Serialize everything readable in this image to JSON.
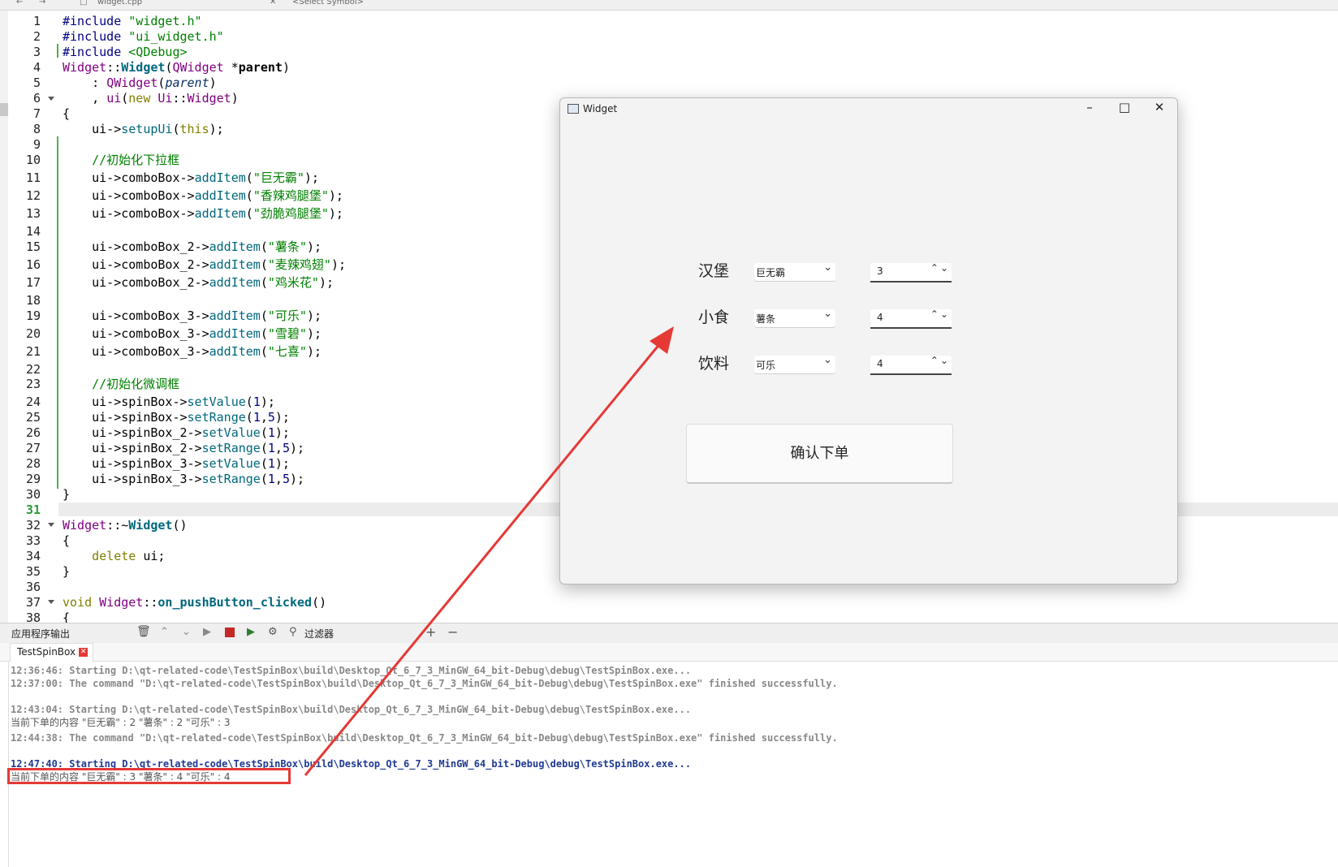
{
  "topbar": {
    "file_tab": "widget.cpp",
    "symbol": "<Select Symbol>"
  },
  "editor": {
    "line_numbers": [
      "1",
      "2",
      "3",
      "4",
      "5",
      "6",
      "7",
      "8",
      "9",
      "10",
      "11",
      "12",
      "13",
      "14",
      "15",
      "16",
      "17",
      "18",
      "19",
      "20",
      "21",
      "22",
      "23",
      "24",
      "25",
      "26",
      "27",
      "28",
      "29",
      "30",
      "31",
      "32",
      "33",
      "34",
      "35",
      "36",
      "37",
      "38"
    ],
    "current_line": "31"
  },
  "code": {
    "l1": [
      "#include ",
      "\"widget.h\""
    ],
    "l2": [
      "#include ",
      "\"ui_widget.h\""
    ],
    "l3": [
      "#include ",
      "<QDebug>"
    ],
    "l4": [
      "Widget",
      "::",
      "Widget",
      "(",
      "QWidget",
      " *",
      "parent",
      ")"
    ],
    "l5": [
      "    : ",
      "QWidget",
      "(",
      "parent",
      ")"
    ],
    "l6": [
      "    , ",
      "ui",
      "(",
      "new",
      " ",
      "Ui",
      "::",
      "Widget",
      ")"
    ],
    "l7": "{",
    "l8": [
      "    ui->",
      "setupUi",
      "(",
      "this",
      ");"
    ],
    "l10": "    //初始化下拉框",
    "l11": [
      "    ui->comboBox->",
      "addItem",
      "(",
      "\"巨无霸\"",
      ");"
    ],
    "l12": [
      "    ui->comboBox->",
      "addItem",
      "(",
      "\"香辣鸡腿堡\"",
      ");"
    ],
    "l13": [
      "    ui->comboBox->",
      "addItem",
      "(",
      "\"劲脆鸡腿堡\"",
      ");"
    ],
    "l15": [
      "    ui->comboBox_2->",
      "addItem",
      "(",
      "\"薯条\"",
      ");"
    ],
    "l16": [
      "    ui->comboBox_2->",
      "addItem",
      "(",
      "\"麦辣鸡翅\"",
      ");"
    ],
    "l17": [
      "    ui->comboBox_2->",
      "addItem",
      "(",
      "\"鸡米花\"",
      ");"
    ],
    "l19": [
      "    ui->comboBox_3->",
      "addItem",
      "(",
      "\"可乐\"",
      ");"
    ],
    "l20": [
      "    ui->comboBox_3->",
      "addItem",
      "(",
      "\"雪碧\"",
      ");"
    ],
    "l21": [
      "    ui->comboBox_3->",
      "addItem",
      "(",
      "\"七喜\"",
      ");"
    ],
    "l23": "    //初始化微调框",
    "l24": [
      "    ui->spinBox->",
      "setValue",
      "(",
      "1",
      ");"
    ],
    "l25": [
      "    ui->spinBox->",
      "setRange",
      "(",
      "1",
      ",",
      "5",
      ");"
    ],
    "l26": [
      "    ui->spinBox_2->",
      "setValue",
      "(",
      "1",
      ");"
    ],
    "l27": [
      "    ui->spinBox_2->",
      "setRange",
      "(",
      "1",
      ",",
      "5",
      ");"
    ],
    "l28": [
      "    ui->spinBox_3->",
      "setValue",
      "(",
      "1",
      ");"
    ],
    "l29": [
      "    ui->spinBox_3->",
      "setRange",
      "(",
      "1",
      ",",
      "5",
      ");"
    ],
    "l30": "}",
    "l32": [
      "Widget",
      "::~",
      "Widget",
      "()"
    ],
    "l33": "{",
    "l34": [
      "    ",
      "delete",
      " ui;"
    ],
    "l35": "}",
    "l37": [
      "void",
      " ",
      "Widget",
      "::",
      "on_pushButton_clicked",
      "()"
    ],
    "l38": "{"
  },
  "output": {
    "title": "应用程序输出",
    "filter_label": "过滤器",
    "tab_label": "TestSpinBox",
    "lines": [
      "12:36:46: Starting D:\\qt-related-code\\TestSpinBox\\build\\Desktop_Qt_6_7_3_MinGW_64_bit-Debug\\debug\\TestSpinBox.exe...",
      "12:37:00: The command \"D:\\qt-related-code\\TestSpinBox\\build\\Desktop_Qt_6_7_3_MinGW_64_bit-Debug\\debug\\TestSpinBox.exe\" finished successfully.",
      "12:43:04: Starting D:\\qt-related-code\\TestSpinBox\\build\\Desktop_Qt_6_7_3_MinGW_64_bit-Debug\\debug\\TestSpinBox.exe...",
      "当前下单的内容 \"巨无霸\" : 2 \"薯条\" : 2 \"可乐\" : 3",
      "12:44:38: The command \"D:\\qt-related-code\\TestSpinBox\\build\\Desktop_Qt_6_7_3_MinGW_64_bit-Debug\\debug\\TestSpinBox.exe\" finished successfully.",
      "12:47:40: Starting D:\\qt-related-code\\TestSpinBox\\build\\Desktop_Qt_6_7_3_MinGW_64_bit-Debug\\debug\\TestSpinBox.exe...",
      "当前下单的内容 \"巨无霸\" : 3 \"薯条\" : 4 \"可乐\" : 4"
    ]
  },
  "widget": {
    "title": "Widget",
    "rows": [
      {
        "label": "汉堡",
        "combo": "巨无霸",
        "spin": "3"
      },
      {
        "label": "小食",
        "combo": "薯条",
        "spin": "4"
      },
      {
        "label": "饮料",
        "combo": "可乐",
        "spin": "4"
      }
    ],
    "confirm_label": "确认下单"
  },
  "colors": {
    "annotation": "#e53935",
    "accent_green": "#4caf50"
  }
}
